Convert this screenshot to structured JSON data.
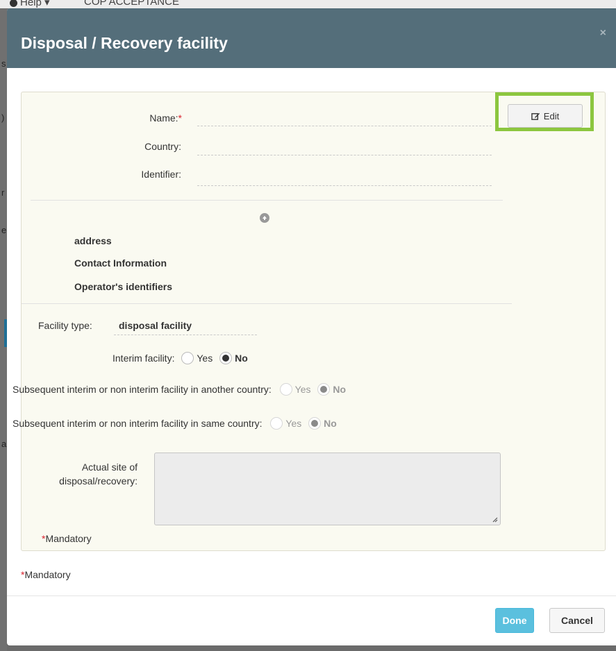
{
  "background": {
    "help_label": "Help",
    "menu_label": "COP ACCEPTANCE"
  },
  "modal": {
    "title": "Disposal / Recovery facility",
    "close_symbol": "×",
    "edit_label": "Edit",
    "fields": {
      "name_label": "Name:",
      "required_mark": "*",
      "country_label": "Country:",
      "identifier_label": "Identifier:",
      "name_value": "",
      "country_value": "",
      "identifier_value": ""
    },
    "sections": [
      "address",
      "Contact Information",
      "Operator's identifiers"
    ],
    "facility_type": {
      "label": "Facility type:",
      "value": "disposal facility"
    },
    "interim": {
      "label": "Interim facility:",
      "yes": "Yes",
      "no": "No",
      "selected": "No"
    },
    "subsequent_other_country": {
      "label": "Subsequent interim or non interim facility in another country:",
      "yes": "Yes",
      "no": "No",
      "selected": "No"
    },
    "subsequent_same_country": {
      "label": "Subsequent interim or non interim facility in same country:",
      "yes": "Yes",
      "no": "No",
      "selected": "No"
    },
    "actual_site": {
      "label_line1": "Actual site of",
      "label_line2": "disposal/recovery:",
      "value": ""
    },
    "mandatory_note": "Mandatory",
    "footer_mandatory_note": "Mandatory",
    "done_label": "Done",
    "cancel_label": "Cancel"
  },
  "colors": {
    "header_bg": "#546e7a",
    "highlight": "#8cc63f",
    "done_bg": "#5bc0de",
    "required": "#d9232e"
  }
}
